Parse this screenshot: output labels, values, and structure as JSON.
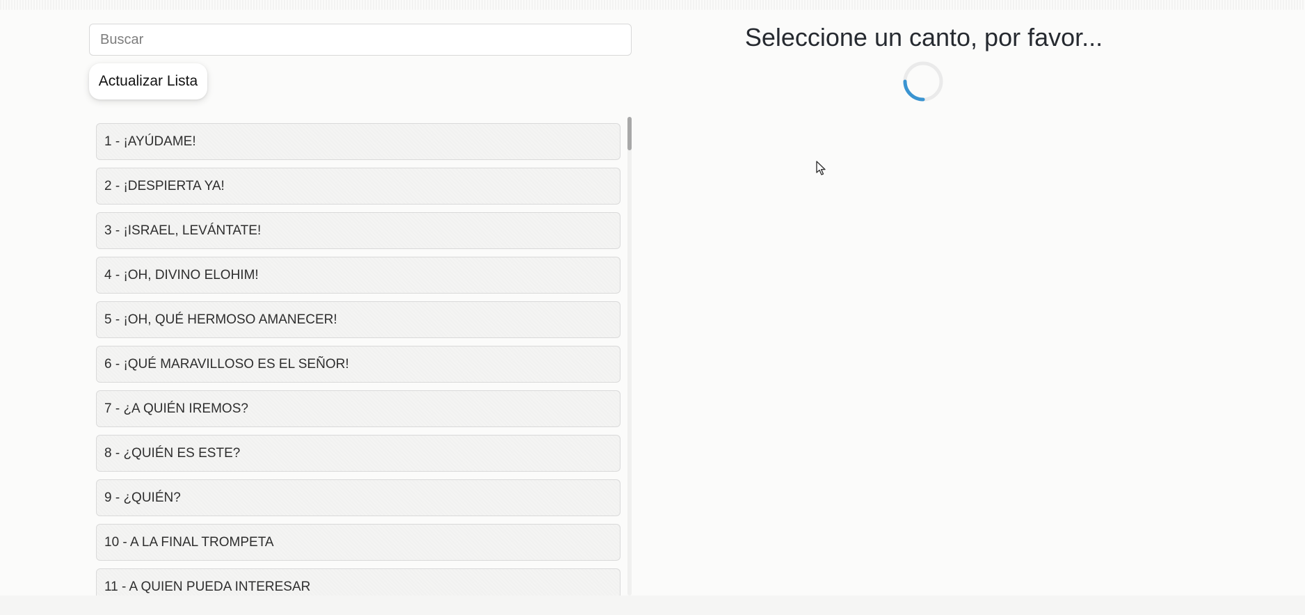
{
  "search": {
    "placeholder": "Buscar",
    "value": ""
  },
  "toolbar": {
    "refresh_label": "Actualizar Lista"
  },
  "main": {
    "title": "Seleccione un canto, por favor..."
  },
  "songs": [
    "1 - ¡AYÚDAME!",
    "2 - ¡DESPIERTA YA!",
    "3 - ¡ISRAEL, LEVÁNTATE!",
    "4 - ¡OH, DIVINO ELOHIM!",
    "5 - ¡OH, QUÉ HERMOSO AMANECER!",
    "6 - ¡QUÉ MARAVILLOSO ES EL SEÑOR!",
    "7 - ¿A QUIÉN IREMOS?",
    "8 - ¿QUIÉN ES ESTE?",
    "9 - ¿QUIÉN?",
    "10 - A LA FINAL TROMPETA",
    "11 - A QUIEN PUEDA INTERESAR"
  ],
  "colors": {
    "background": "#fbfbfa",
    "spinner_track": "#eaeaea",
    "spinner_accent": "#3a94d1",
    "item_border": "#d9d9d9",
    "item_background": "#f4f4f3"
  },
  "icons": {
    "loading": "spinner-icon",
    "pointer": "cursor-icon"
  }
}
